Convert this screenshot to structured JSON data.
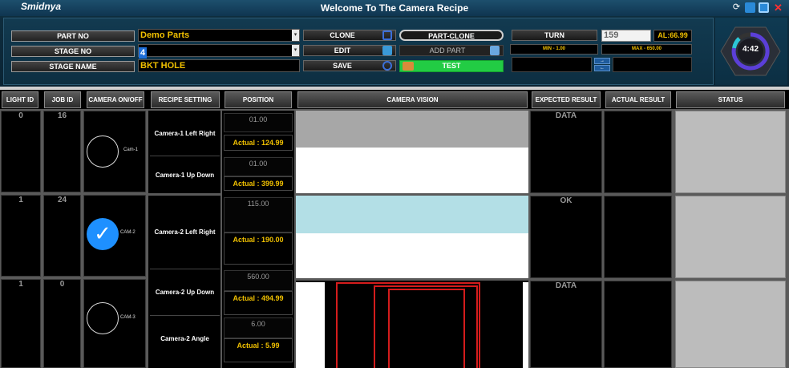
{
  "app": {
    "brand": "Smidnya",
    "title": "Welcome To The Camera Recipe"
  },
  "form": {
    "part_no_label": "PART NO",
    "part_no_value": "Demo Parts",
    "stage_no_label": "STAGE NO",
    "stage_no_value": "4",
    "stage_name_label": "STAGE NAME",
    "stage_name_value": "BKT HOLE"
  },
  "buttons": {
    "clone": "CLONE",
    "edit": "EDIT",
    "save": "SAVE",
    "part_clone": "PART-CLONE",
    "add_part": "ADD PART",
    "test": "TEST",
    "turn": "TURN"
  },
  "turn": {
    "value": "159",
    "al": "AL:66.99",
    "min": "MIN - 1.00",
    "max": "MAX - 650.00"
  },
  "timer": "4:42",
  "columns": {
    "light_id": "LIGHT ID",
    "job_id": "JOB ID",
    "camera_onoff": "CAMERA ON/OFF",
    "recipe_setting": "RECIPE SETTING",
    "position": "POSITION",
    "camera_vision": "CAMERA VISION",
    "expected_result": "EXPECTED RESULT",
    "actual_result": "ACTUAL RESULT",
    "status": "STATUS"
  },
  "rows": [
    {
      "light_id": "0",
      "job_id": "16",
      "cam": "Cam-1",
      "expected": "DATA"
    },
    {
      "light_id": "1",
      "job_id": "24",
      "cam": "CAM-2",
      "expected": "OK"
    },
    {
      "light_id": "1",
      "job_id": "0",
      "cam": "CAM-3",
      "expected": "DATA"
    }
  ],
  "recipes": [
    "Camera-1 Left Right",
    "Camera-1 Up Down",
    "Camera-2 Left Right",
    "Camera-2 Up Down",
    "Camera-2 Angle"
  ],
  "positions": [
    {
      "pos": "01.00",
      "actual": "Actual : 124.99"
    },
    {
      "pos": "01.00",
      "actual": "Actual : 399.99"
    },
    {
      "pos": "115.00",
      "actual": "Actual : 190.00"
    },
    {
      "pos": "560.00",
      "actual": "Actual : 494.99"
    },
    {
      "pos": "6.00",
      "actual": "Actual : 5.99"
    }
  ],
  "colors": {
    "accent_yellow": "#f0c000",
    "test_green": "#22cc44",
    "cam_checked_blue": "#1e90ff"
  }
}
